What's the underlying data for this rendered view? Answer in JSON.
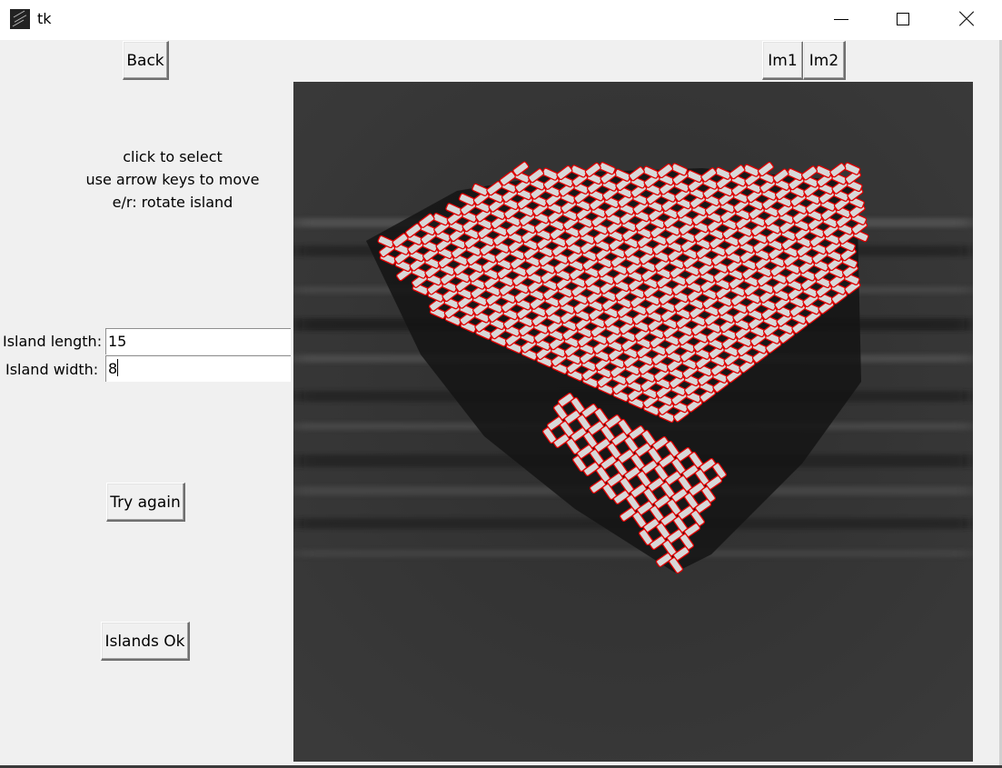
{
  "window": {
    "title": "tk",
    "icon": "feather-icon",
    "controls": [
      "minimize-icon",
      "maximize-icon",
      "close-icon"
    ]
  },
  "toolbar": {
    "back_label": "Back",
    "im1_label": "Im1",
    "im2_label": "Im2"
  },
  "instructions": {
    "line1": "click to select",
    "line2": "use arrow keys to move",
    "line3": "e/r: rotate island"
  },
  "fields": {
    "length_label": "Island length:",
    "length_value": "15",
    "width_label": "Island width:",
    "width_value": "8"
  },
  "actions": {
    "try_again_label": "Try again",
    "islands_ok_label": "Islands Ok"
  },
  "image": {
    "content": "grayscale microscope image of a nanomagnet island lattice with red outline overlays",
    "overlay_color": "#e00000"
  }
}
